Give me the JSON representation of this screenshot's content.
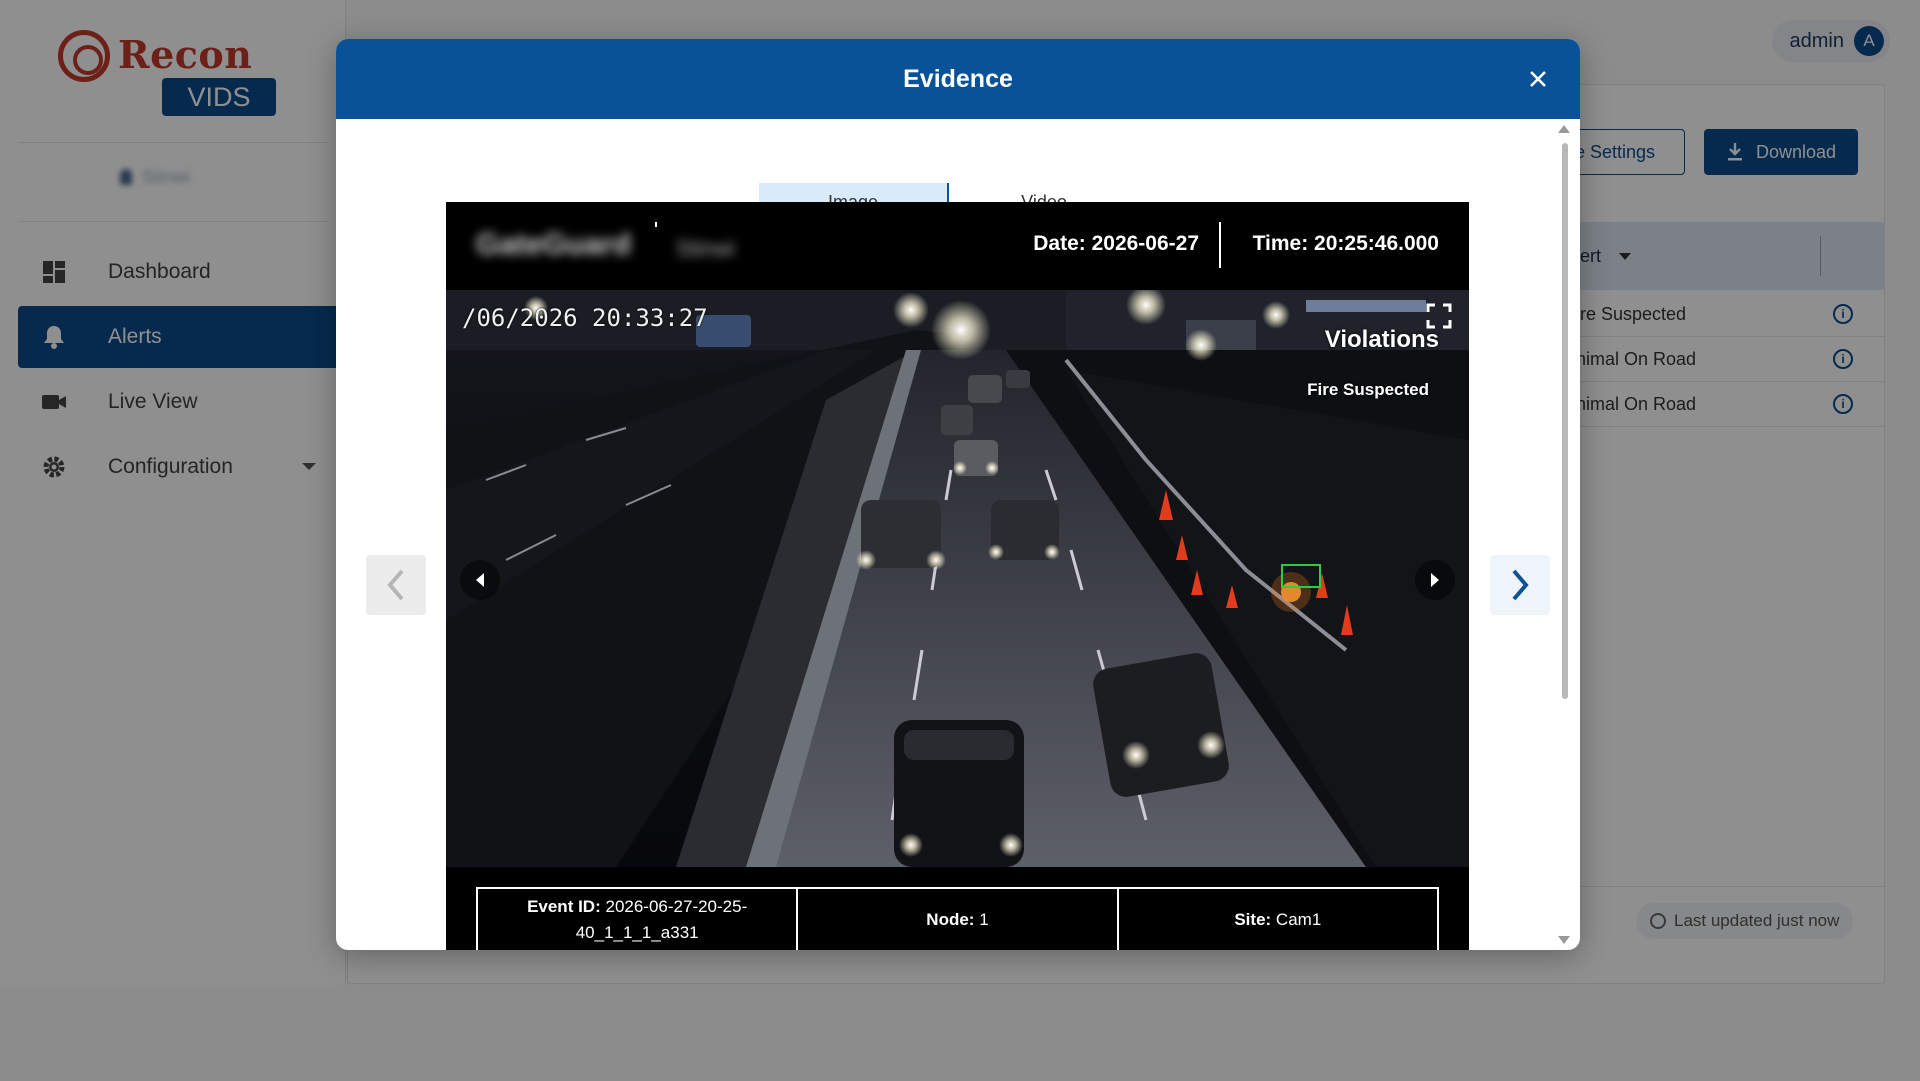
{
  "app": {
    "logo_text": "Recon",
    "logo_sub": "VIDS",
    "site_label": "Stinwi",
    "user": {
      "name": "admin",
      "initial": "A"
    }
  },
  "sidebar": {
    "items": [
      {
        "label": "Dashboard",
        "icon": "dashboard-icon"
      },
      {
        "label": "Alerts",
        "icon": "bell-icon"
      },
      {
        "label": "Live View",
        "icon": "camera-icon"
      },
      {
        "label": "Configuration",
        "icon": "gear-icon"
      }
    ]
  },
  "background": {
    "settings_button": "e Settings",
    "download_button": "Download",
    "column_header": "lert",
    "rows": [
      "ire Suspected",
      "nimal On Road",
      "nimal On Road"
    ],
    "last_updated": "Last updated just now"
  },
  "modal": {
    "title": "Evidence",
    "tabs": [
      {
        "label": "Image",
        "active": true
      },
      {
        "label": "Video",
        "active": false
      }
    ],
    "evidence": {
      "brand": "GateGuard",
      "brand_sub": "Stinwi",
      "date": "Date: 2026-06-27",
      "time": "Time: 20:25:46.000",
      "osd_timestamp": "/06/2026 20:33:27",
      "violations_title": "Violations",
      "violation_item": "Fire Suspected",
      "event_id_label": "Event ID:",
      "event_id_value": "2026-06-27-20-25-40_1_1_1_a331",
      "node_label": "Node:",
      "node_value": "1",
      "site_label": "Site:",
      "site_value": "Cam1"
    }
  },
  "colors": {
    "primary": "#0a5298",
    "brand_red": "#c0392b",
    "tab_active_bg": "#d8ebfa",
    "detection_box": "#2ecc40"
  }
}
